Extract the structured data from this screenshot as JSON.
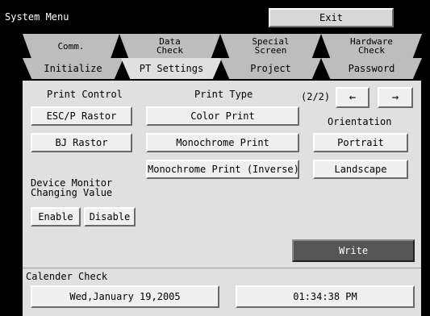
{
  "window": {
    "title": "System Menu",
    "exit_label": "Exit"
  },
  "tabs_top": [
    {
      "label": "Comm."
    },
    {
      "label": "Data Check"
    },
    {
      "label": "Special Screen"
    },
    {
      "label": "Hardware Check"
    }
  ],
  "tabs_bottom": [
    {
      "label": "Initialize"
    },
    {
      "label": "PT Settings",
      "active": true
    },
    {
      "label": "Project"
    },
    {
      "label": "Password"
    }
  ],
  "print_control": {
    "heading": "Print Control",
    "options": [
      "ESC/P Rastor",
      "BJ Rastor"
    ]
  },
  "print_type": {
    "heading": "Print Type",
    "options": [
      "Color Print",
      "Monochrome Print",
      "Monochrome Print (Inverse)"
    ]
  },
  "pager": {
    "page": "(2/2)",
    "prev": "←",
    "next": "→"
  },
  "orientation": {
    "heading": "Orientation",
    "options": [
      "Portrait",
      "Landscape"
    ]
  },
  "device_monitor": {
    "heading_line1": "Device Monitor",
    "heading_line2": "Changing Value",
    "enable": "Enable",
    "disable": "Disable"
  },
  "write_label": "Write",
  "calendar": {
    "heading": "Calender Check",
    "date": "Wed,January 19,2005",
    "time": "01:34:38 PM"
  }
}
